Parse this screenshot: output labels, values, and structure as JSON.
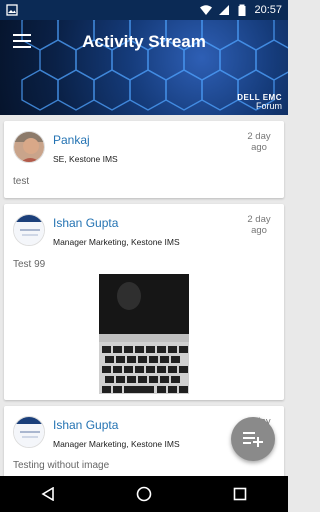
{
  "status_bar": {
    "time": "20:57"
  },
  "header": {
    "title": "Activity Stream",
    "brand_line1": "DELL EMC",
    "brand_line2": "Forum"
  },
  "posts": [
    {
      "name": "Pankaj",
      "role": "SE, Kestone IMS",
      "time": "2 day ago",
      "text": "test"
    },
    {
      "name": "Ishan Gupta",
      "role": "Manager Marketing, Kestone IMS",
      "time": "2 day ago",
      "text": "Test 99"
    },
    {
      "name": "Ishan Gupta",
      "role": "Manager Marketing, Kestone IMS",
      "time": "2 day ago",
      "text": "Testing without image"
    }
  ],
  "icons": {
    "menu": "hamburger-icon",
    "fab": "playlist-add-icon",
    "nav_back": "back-triangle-icon",
    "nav_home": "home-circle-icon",
    "nav_recents": "recents-square-icon"
  },
  "colors": {
    "accent": "#2473b3",
    "header_bg": "#0a2147",
    "fab": "#8a8a8a"
  }
}
